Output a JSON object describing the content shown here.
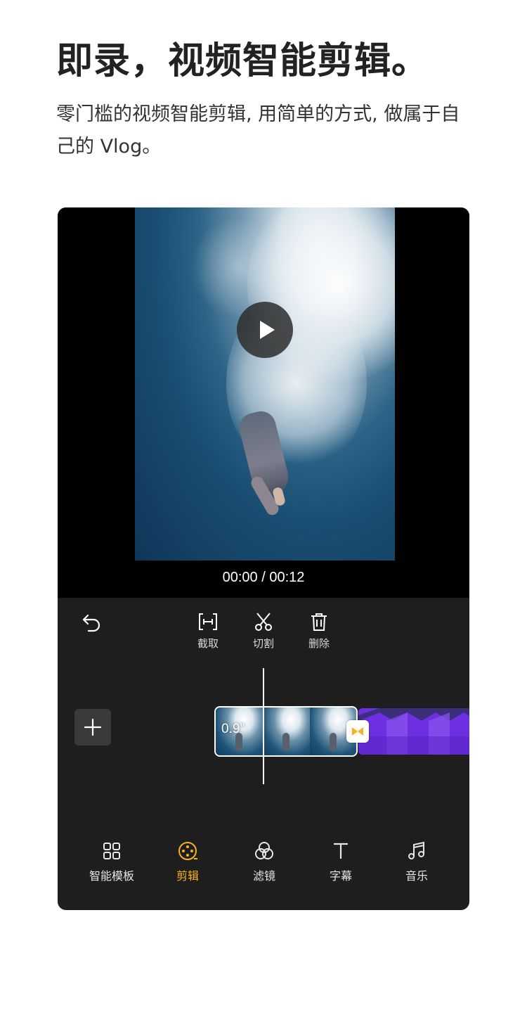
{
  "headline": "即录，视频智能剪辑。",
  "subtitle": "零门槛的视频智能剪辑, 用简单的方式, 做属于自己的 Vlog。",
  "player": {
    "time_display": "00:00 / 00:12"
  },
  "toolbar": {
    "trim_label": "截取",
    "split_label": "切割",
    "delete_label": "删除"
  },
  "timeline": {
    "clip_duration": "0.9\""
  },
  "bottom_nav": {
    "items": [
      {
        "label": "智能模板",
        "icon": "grid-icon",
        "active": false
      },
      {
        "label": "剪辑",
        "icon": "film-reel-icon",
        "active": true
      },
      {
        "label": "滤镜",
        "icon": "filter-circles-icon",
        "active": false
      },
      {
        "label": "字幕",
        "icon": "text-t-icon",
        "active": false
      },
      {
        "label": "音乐",
        "icon": "music-note-icon",
        "active": false
      }
    ]
  },
  "colors": {
    "accent": "#f9b21c",
    "panel_bg": "#1e1e1e",
    "clip2": "#6d2fe0"
  }
}
